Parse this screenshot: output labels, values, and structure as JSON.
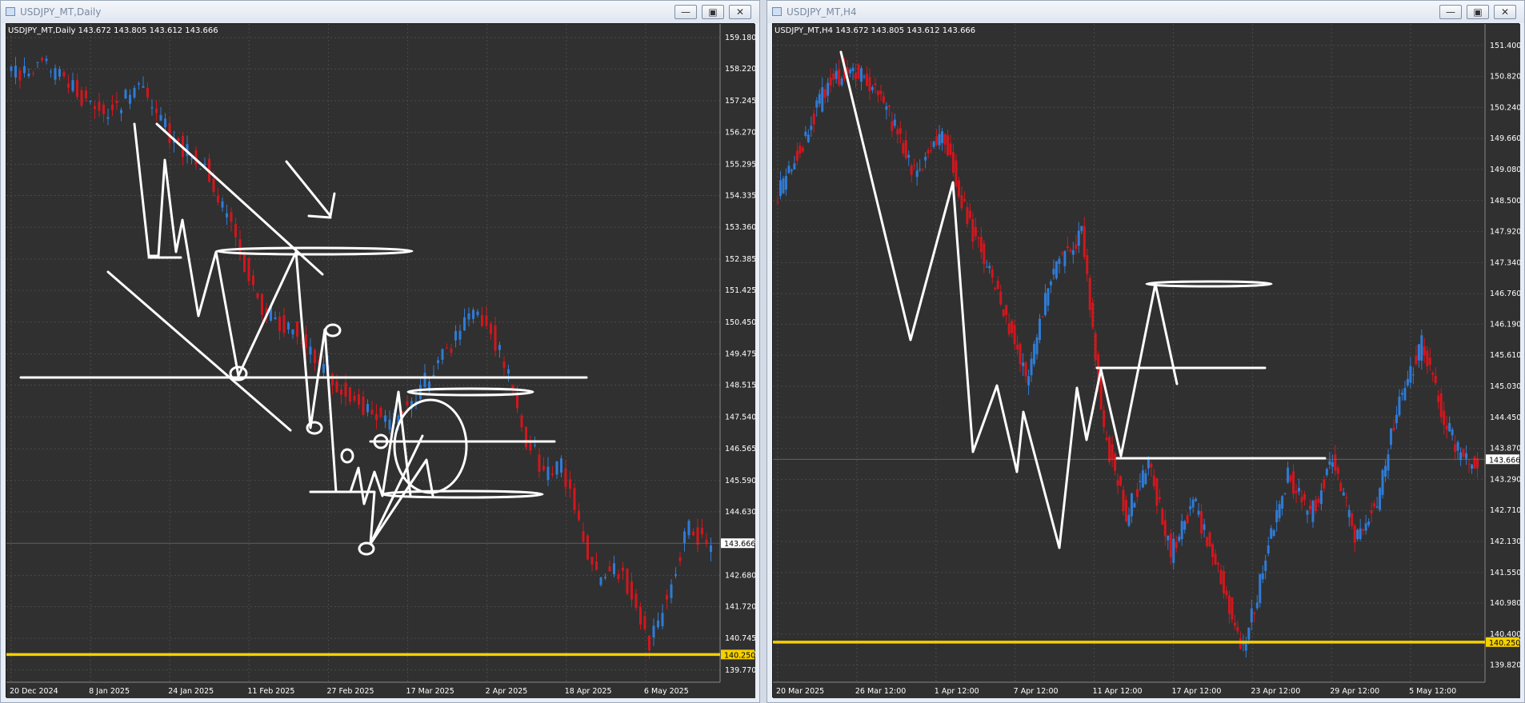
{
  "colors": {
    "background": "#303030",
    "grid": "#4a4a4a",
    "axis_text": "#ffffff",
    "bull_candle": "#2f7bd6",
    "bear_candle": "#d2161d",
    "support_line": "#f5d000",
    "drawing": "#ffffff"
  },
  "windows": [
    {
      "title": "USDJPY_MT,Daily",
      "legend": "USDJPY_MT,Daily  143.672 143.805 143.612 143.666",
      "controls": {
        "minimize": "—",
        "maximize": "▣",
        "close": "✕"
      },
      "chart_data": {
        "type": "candlestick",
        "symbol": "USDJPY_MT",
        "timeframe": "Daily",
        "ohlc_last": {
          "open": 143.672,
          "high": 143.805,
          "low": 143.612,
          "close": 143.666
        },
        "ylim": [
          139.4,
          159.6
        ],
        "y_ticks": [
          "159.180",
          "158.220",
          "157.245",
          "156.270",
          "155.295",
          "154.335",
          "153.360",
          "152.385",
          "151.425",
          "150.450",
          "149.475",
          "148.515",
          "147.540",
          "146.565",
          "145.590",
          "144.630",
          "143.666",
          "142.680",
          "141.720",
          "140.745",
          "140.250",
          "139.770"
        ],
        "x_labels": [
          "20 Dec 2024",
          "8 Jan 2025",
          "24 Jan 2025",
          "11 Feb 2025",
          "27 Feb 2025",
          "17 Mar 2025",
          "2 Apr 2025",
          "18 Apr 2025",
          "6 May 2025"
        ],
        "current_price": "143.666",
        "price_levels": [
          {
            "label": "140.250",
            "value": 140.25,
            "color": "#f5d000"
          }
        ],
        "path": [
          [
            0,
            158.0
          ],
          [
            8,
            158.4
          ],
          [
            15,
            157.6
          ],
          [
            22,
            156.8
          ],
          [
            30,
            157.6
          ],
          [
            38,
            156.0
          ],
          [
            45,
            155.2
          ],
          [
            52,
            153.0
          ],
          [
            58,
            150.8
          ],
          [
            65,
            150.2
          ],
          [
            72,
            149.0
          ],
          [
            79,
            148.0
          ],
          [
            86,
            147.4
          ],
          [
            93,
            148.2
          ],
          [
            100,
            149.6
          ],
          [
            106,
            150.8
          ],
          [
            110,
            150.2
          ],
          [
            114,
            148.8
          ],
          [
            118,
            146.9
          ],
          [
            122,
            145.9
          ],
          [
            126,
            146.0
          ],
          [
            130,
            144.2
          ],
          [
            134,
            142.6
          ],
          [
            137,
            143.0
          ],
          [
            140,
            142.6
          ],
          [
            143,
            141.6
          ],
          [
            146,
            140.6
          ],
          [
            149,
            141.8
          ],
          [
            152,
            143.0
          ],
          [
            155,
            144.2
          ],
          [
            158,
            143.7
          ],
          [
            160,
            143.6
          ]
        ],
        "n_days": 160
      }
    },
    {
      "title": "USDJPY_MT,H4",
      "legend": "USDJPY_MT,H4  143.672 143.805 143.612 143.666",
      "controls": {
        "minimize": "—",
        "maximize": "▣",
        "close": "✕"
      },
      "chart_data": {
        "type": "candlestick",
        "symbol": "USDJPY_MT",
        "timeframe": "H4",
        "ohlc_last": {
          "open": 143.672,
          "high": 143.805,
          "low": 143.612,
          "close": 143.666
        },
        "ylim": [
          139.5,
          151.8
        ],
        "y_ticks": [
          "151.400",
          "150.820",
          "150.240",
          "149.660",
          "149.080",
          "148.500",
          "147.920",
          "147.340",
          "146.760",
          "146.190",
          "145.610",
          "145.030",
          "144.450",
          "143.870",
          "143.290",
          "142.710",
          "142.130",
          "141.550",
          "140.980",
          "140.400",
          "140.250",
          "139.820"
        ],
        "x_labels": [
          "20 Mar 2025",
          "26 Mar 12:00",
          "1 Apr 12:00",
          "7 Apr 12:00",
          "11 Apr 12:00",
          "17 Apr 12:00",
          "23 Apr 12:00",
          "29 Apr 12:00",
          "5 May 12:00"
        ],
        "current_price": "143.666",
        "price_levels": [
          {
            "label": "140.250",
            "value": 140.25,
            "color": "#f5d000"
          }
        ],
        "path": [
          [
            0,
            148.5
          ],
          [
            10,
            149.6
          ],
          [
            20,
            150.8
          ],
          [
            30,
            150.9
          ],
          [
            40,
            150.2
          ],
          [
            50,
            149.0
          ],
          [
            60,
            149.8
          ],
          [
            70,
            148.0
          ],
          [
            80,
            146.8
          ],
          [
            90,
            145.2
          ],
          [
            100,
            147.2
          ],
          [
            110,
            147.9
          ],
          [
            118,
            144.2
          ],
          [
            126,
            142.6
          ],
          [
            134,
            143.6
          ],
          [
            142,
            141.9
          ],
          [
            150,
            142.9
          ],
          [
            160,
            141.4
          ],
          [
            168,
            140.1
          ],
          [
            176,
            141.8
          ],
          [
            184,
            143.4
          ],
          [
            192,
            142.6
          ],
          [
            200,
            143.7
          ],
          [
            208,
            142.2
          ],
          [
            216,
            142.9
          ],
          [
            224,
            144.8
          ],
          [
            232,
            145.8
          ],
          [
            240,
            144.4
          ],
          [
            246,
            143.7
          ],
          [
            252,
            143.6
          ]
        ],
        "n_days": 252
      }
    }
  ]
}
